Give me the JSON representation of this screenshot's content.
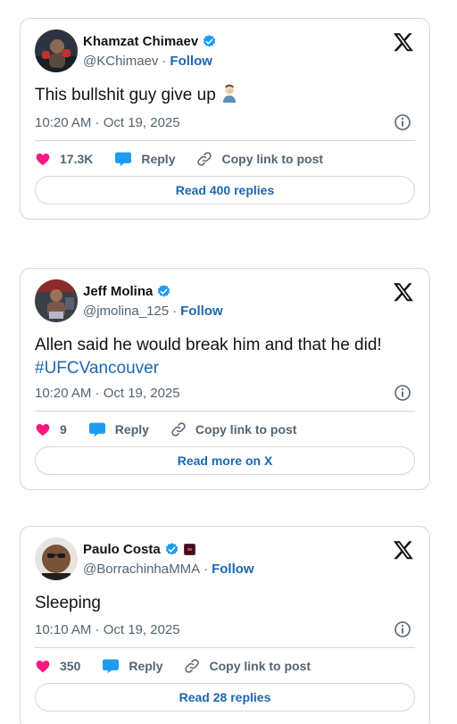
{
  "colors": {
    "link": "#1d67b0",
    "verified": "#1d9bf0",
    "like": "#f91880",
    "reply": "#1d9bf0",
    "muted": "#536471",
    "border": "#cfd9de"
  },
  "tweets": [
    {
      "name": "Khamzat Chimaev",
      "handle": "@KChimaev",
      "dot": "·",
      "follow": "Follow",
      "text": "This bullshit guy give up",
      "emoji": "man-facepalming-emoji",
      "hashtag": "",
      "timestamp": "10:20 AM · Oct 19, 2025",
      "likes": "17.3K",
      "reply": "Reply",
      "copy": "Copy link to post",
      "button": "Read 400 replies"
    },
    {
      "name": "Jeff Molina",
      "handle": "@jmolina_125",
      "dot": "·",
      "follow": "Follow",
      "text": "Allen said he would break him and that he did!",
      "hashtag": "#UFCVancouver",
      "timestamp": "10:20 AM · Oct 19, 2025",
      "likes": "9",
      "reply": "Reply",
      "copy": "Copy link to post",
      "button": "Read more on X"
    },
    {
      "name": "Paulo Costa",
      "handle": "@BorrachinhaMMA",
      "dot": "·",
      "follow": "Follow",
      "text": "Sleeping",
      "hashtag": "",
      "timestamp": "10:10 AM · Oct 19, 2025",
      "likes": "350",
      "reply": "Reply",
      "copy": "Copy link to post",
      "button": "Read 28 replies"
    }
  ]
}
